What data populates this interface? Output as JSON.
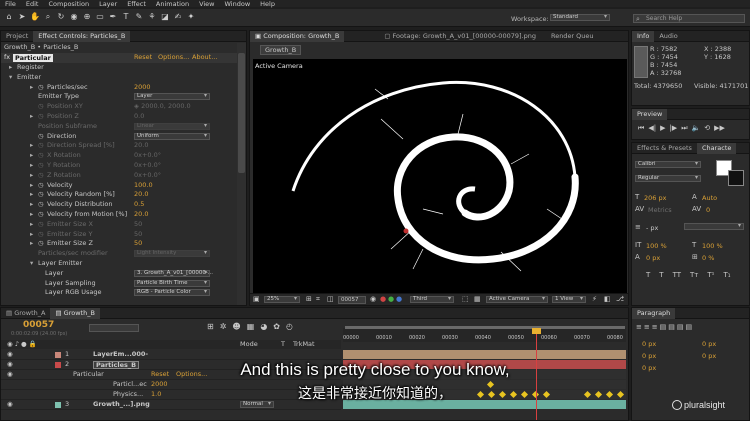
{
  "menubar": {
    "items": [
      "File",
      "Edit",
      "Composition",
      "Layer",
      "Effect",
      "Animation",
      "View",
      "Window",
      "Help"
    ]
  },
  "toolbar": {
    "workspace_label": "Workspace:",
    "workspace_value": "Standard",
    "search_placeholder": "Search Help"
  },
  "left_panel": {
    "tabs": [
      "Project",
      "Effect Controls: Particles_B"
    ],
    "breadcrumb": "Growth_B • Particles_B",
    "effect_name": "Particular",
    "effect_links": [
      "Reset",
      "Options...",
      "About..."
    ],
    "rows": [
      {
        "label": "Register",
        "indent": 0,
        "arrow": "▸",
        "value": "",
        "stopwatch": false,
        "dim": false
      },
      {
        "label": "Emitter",
        "indent": 0,
        "arrow": "▾",
        "value": "",
        "stopwatch": false,
        "dim": false
      },
      {
        "label": "Particles/sec",
        "indent": 1,
        "arrow": "▸",
        "value": "2000",
        "stopwatch": true,
        "dim": false
      },
      {
        "label": "Emitter Type",
        "indent": 1,
        "arrow": "",
        "value": "",
        "dropdown": "Layer",
        "stopwatch": false,
        "dim": false
      },
      {
        "label": "Position XY",
        "indent": 1,
        "arrow": "",
        "value": "◈ 2000.0, 2000.0",
        "stopwatch": true,
        "dim": true
      },
      {
        "label": "Position Z",
        "indent": 1,
        "arrow": "▸",
        "value": "0.0",
        "stopwatch": true,
        "dim": true
      },
      {
        "label": "Position Subframe",
        "indent": 1,
        "arrow": "",
        "value": "",
        "dropdown": "Linear",
        "stopwatch": false,
        "dim": true
      },
      {
        "label": "Direction",
        "indent": 1,
        "arrow": "",
        "value": "",
        "dropdown": "Uniform",
        "stopwatch": true,
        "dim": false
      },
      {
        "label": "Direction Spread [%]",
        "indent": 1,
        "arrow": "▸",
        "value": "20.0",
        "stopwatch": true,
        "dim": true
      },
      {
        "label": "X Rotation",
        "indent": 1,
        "arrow": "▸",
        "value": "0x+0.0°",
        "stopwatch": true,
        "dim": true
      },
      {
        "label": "Y Rotation",
        "indent": 1,
        "arrow": "▸",
        "value": "0x+0.0°",
        "stopwatch": true,
        "dim": true
      },
      {
        "label": "Z Rotation",
        "indent": 1,
        "arrow": "▸",
        "value": "0x+0.0°",
        "stopwatch": true,
        "dim": true
      },
      {
        "label": "Velocity",
        "indent": 1,
        "arrow": "▸",
        "value": "100.0",
        "stopwatch": true,
        "dim": false
      },
      {
        "label": "Velocity Random [%]",
        "indent": 1,
        "arrow": "▸",
        "value": "20.0",
        "stopwatch": true,
        "dim": false
      },
      {
        "label": "Velocity Distribution",
        "indent": 1,
        "arrow": "▸",
        "value": "0.5",
        "stopwatch": true,
        "dim": false
      },
      {
        "label": "Velocity from Motion [%]",
        "indent": 1,
        "arrow": "▸",
        "value": "20.0",
        "stopwatch": true,
        "dim": false
      },
      {
        "label": "Emitter Size X",
        "indent": 1,
        "arrow": "▸",
        "value": "50",
        "stopwatch": true,
        "dim": true
      },
      {
        "label": "Emitter Size Y",
        "indent": 1,
        "arrow": "▸",
        "value": "50",
        "stopwatch": true,
        "dim": true
      },
      {
        "label": "Emitter Size Z",
        "indent": 1,
        "arrow": "▸",
        "value": "50",
        "stopwatch": true,
        "dim": false
      },
      {
        "label": "Particles/sec modifier",
        "indent": 1,
        "arrow": "",
        "value": "",
        "dropdown": "Light Intensity",
        "stopwatch": false,
        "dim": true
      },
      {
        "label": "Layer Emitter",
        "indent": 1,
        "arrow": "▾",
        "value": "",
        "stopwatch": false,
        "dim": false
      },
      {
        "label": "Layer",
        "indent": 2,
        "arrow": "",
        "value": "",
        "dropdown": "3. Growth_A_v01_[00000-...",
        "stopwatch": false,
        "dim": false
      },
      {
        "label": "Layer Sampling",
        "indent": 2,
        "arrow": "",
        "value": "",
        "dropdown": "Particle Birth Time",
        "stopwatch": false,
        "dim": false
      },
      {
        "label": "Layer RGB Usage",
        "indent": 2,
        "arrow": "",
        "value": "",
        "dropdown": "RGB - Particle Color",
        "stopwatch": false,
        "dim": false
      }
    ]
  },
  "viewer": {
    "tabs": [
      "Composition: Growth_B",
      "Footage: Growth_A_v01_[00000-00079].png",
      "Render Queu"
    ],
    "sub_tab": "Growth_B",
    "camera_label": "Active Camera",
    "zoom": "25%",
    "timecode": "00057",
    "resolution": "Third",
    "camera_view": "Active Camera",
    "views": "1 View"
  },
  "info_panel": {
    "tabs": [
      "Info",
      "Audio"
    ],
    "r": "R : 7582",
    "g": "G : 7454",
    "b": "B : 7454",
    "a": "A : 32768",
    "x": "X : 2388",
    "y": "Y : 1628",
    "total": "Total: 4379650",
    "visible": "Visible: 4171701"
  },
  "preview_panel": {
    "title": "Preview"
  },
  "character_panel": {
    "tabs": [
      "Effects & Presets",
      "Characte"
    ],
    "font": "Calibri",
    "style": "Regular",
    "size": "206 px",
    "leading": "Auto",
    "kerning": "Metrics",
    "tracking": "0",
    "indent": "- px",
    "vscale": "100 %",
    "hscale": "100 %",
    "baseline": "0 px",
    "tsume": "0 %"
  },
  "paragraph_panel": {
    "title": "Paragraph",
    "values": [
      "0 px",
      "0 px",
      "0 px",
      "0 px",
      "0 px"
    ]
  },
  "timeline": {
    "tabs": [
      "Growth_A",
      "Growth_B"
    ],
    "timecode": "00057",
    "fps": "0:00:02:09 (24.00 fps)",
    "ruler": [
      "00000",
      "00010",
      "00020",
      "00030",
      "00040",
      "00050",
      "00060",
      "00070",
      "00080"
    ],
    "columns": {
      "mode": "Mode",
      "t": "T",
      "trkmat": "TrkMat"
    },
    "layers": [
      {
        "num": "1",
        "name": "LayerEm...000-",
        "color": "#c9877a"
      },
      {
        "num": "2",
        "name": "Particles_B",
        "color": "#c94a4a"
      },
      {
        "num": "",
        "name": "Particular",
        "color": ""
      },
      {
        "num": "",
        "name": "Particl...ec",
        "value": "2000"
      },
      {
        "num": "",
        "name": "Physics...",
        "value": "1.0"
      },
      {
        "num": "3",
        "name": "Growth_...].png",
        "mode": "Normal",
        "color": "#7fc2b0"
      }
    ],
    "effect_links": [
      "Reset",
      "Options..."
    ]
  },
  "subtitles": {
    "line1": "And this is pretty close to you know,",
    "line2": "这是非常接近你知道的，"
  },
  "watermark": "pluralsight"
}
